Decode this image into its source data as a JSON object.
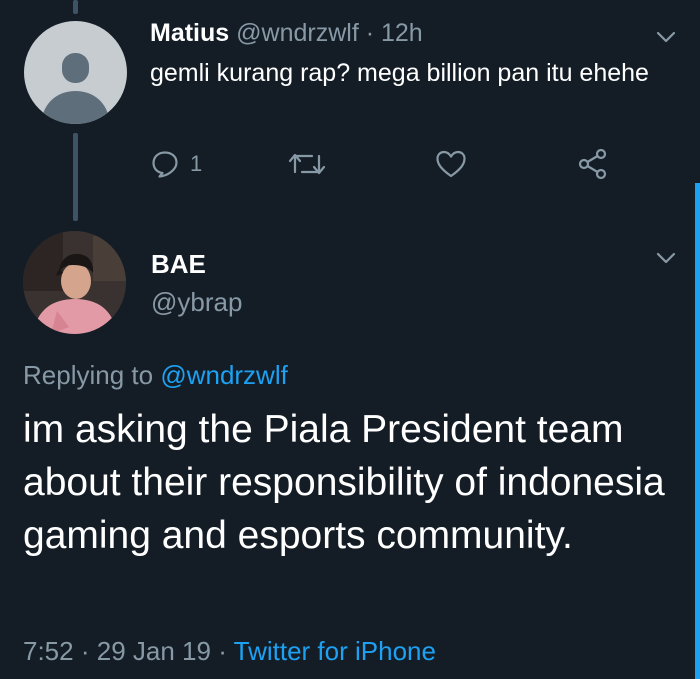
{
  "reply_tweet": {
    "author_name": "Matius",
    "author_handle": "@wndrzwlf",
    "separator": "·",
    "time_ago": "12h",
    "text": "gemli kurang rap? mega billion pan itu ehehe",
    "actions": {
      "reply_icon": "reply-icon",
      "reply_count": "1",
      "retweet_icon": "retweet-icon",
      "like_icon": "heart-icon",
      "share_icon": "share-icon"
    }
  },
  "main_tweet": {
    "author_name": "BAE",
    "author_handle": "@ybrap",
    "replying_prefix": "Replying to",
    "replying_to": "@wndrzwlf",
    "text": "im asking the Piala President team about their responsibility of indonesia gaming and esports community.",
    "time": "7:52",
    "separator1": "·",
    "date": "29 Jan 19",
    "separator2": "·",
    "source": "Twitter for iPhone"
  },
  "colors": {
    "background": "#141d26",
    "text_primary": "#ffffff",
    "text_secondary": "#8899a6",
    "accent": "#1da1f2",
    "thread_line": "#3d5466"
  }
}
